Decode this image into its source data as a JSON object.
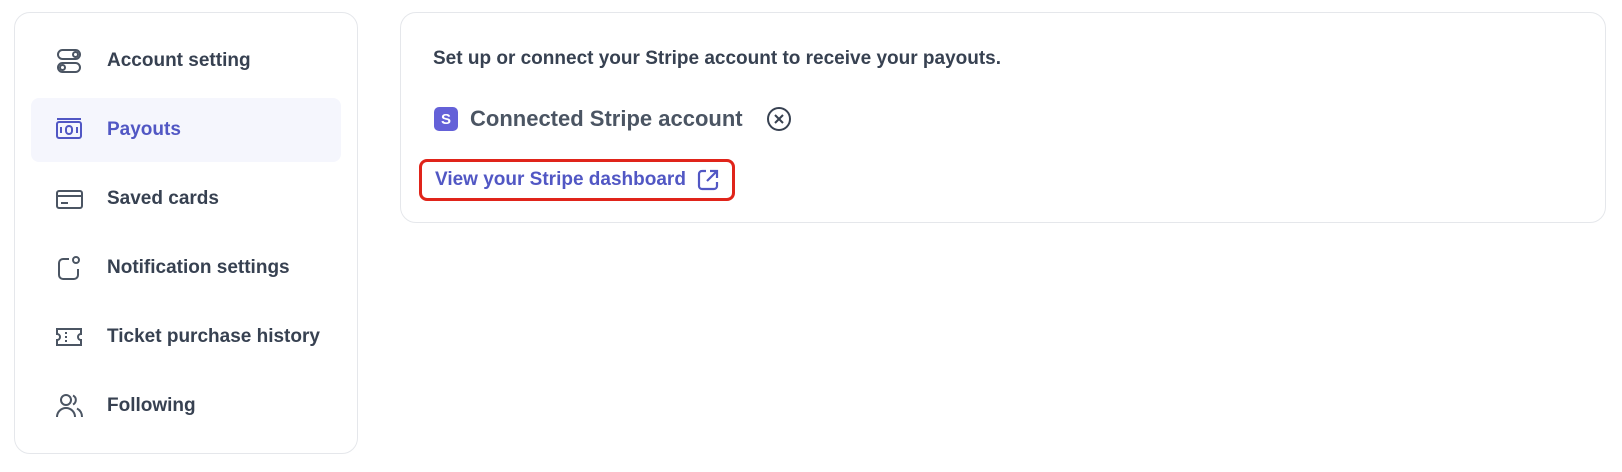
{
  "sidebar": {
    "items": [
      {
        "label": "Account setting",
        "icon": "toggles-icon",
        "active": false
      },
      {
        "label": "Payouts",
        "icon": "money-icon",
        "active": true
      },
      {
        "label": "Saved cards",
        "icon": "credit-card-icon",
        "active": false
      },
      {
        "label": "Notification settings",
        "icon": "notification-icon",
        "active": false
      },
      {
        "label": "Ticket purchase history",
        "icon": "ticket-icon",
        "active": false
      },
      {
        "label": "Following",
        "icon": "users-icon",
        "active": false
      }
    ]
  },
  "payouts": {
    "intro": "Set up or connect your Stripe account to receive your payouts.",
    "stripe_badge": "S",
    "connected_label": "Connected Stripe account",
    "dashboard_link": "View your Stripe dashboard"
  },
  "colors": {
    "accent": "#5157c4",
    "stripe": "#6461d8",
    "highlight_border": "#e0241a",
    "active_bg": "#f5f6fd"
  }
}
